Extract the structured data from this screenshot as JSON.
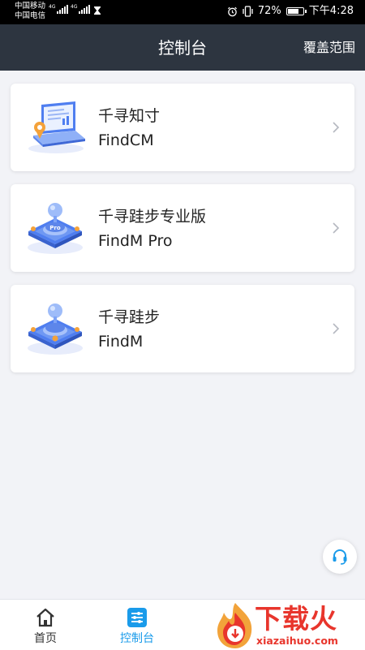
{
  "status_bar": {
    "carrier1": "中国移动",
    "carrier2": "中国电信",
    "net1": "4G",
    "net2": "4G",
    "battery": "72%",
    "time": "下午4:28"
  },
  "header": {
    "title": "控制台",
    "right_action": "覆盖范围"
  },
  "cards": [
    {
      "name": "千寻知寸",
      "sub": "FindCM",
      "icon": "laptop-location-icon"
    },
    {
      "name": "千寻跬步专业版",
      "sub": "FindM Pro",
      "icon": "pro-station-icon"
    },
    {
      "name": "千寻跬步",
      "sub": "FindM",
      "icon": "station-icon"
    }
  ],
  "support_button": {
    "icon": "headset-icon"
  },
  "bottom_nav": {
    "items": [
      {
        "label": "首页",
        "icon": "home-icon",
        "active": false
      },
      {
        "label": "控制台",
        "icon": "console-icon",
        "active": true
      }
    ],
    "active_color": "#1a9bea",
    "inactive_color": "#333333"
  },
  "watermark": {
    "text": "下载火",
    "url": "xiazaihuo.com"
  }
}
